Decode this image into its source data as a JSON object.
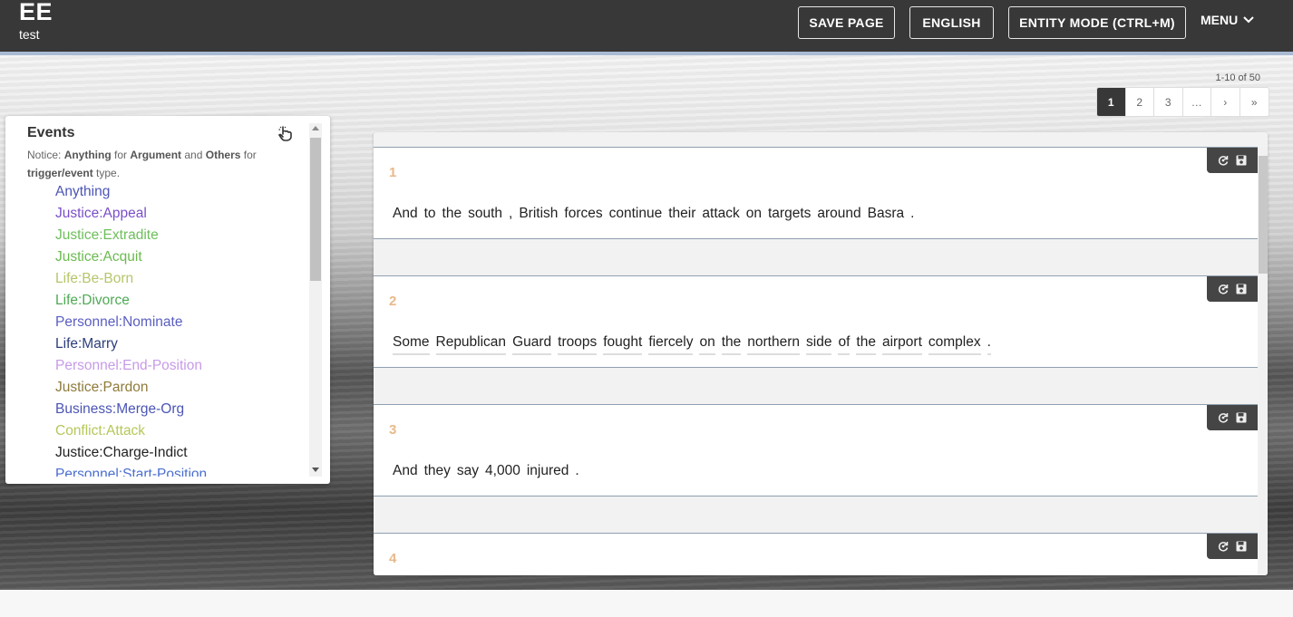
{
  "header": {
    "app_title": "EE",
    "app_subtitle": "test",
    "buttons": {
      "save_page": "SAVE PAGE",
      "language": "ENGLISH",
      "entity_mode": "ENTITY MODE (CTRL+M)",
      "menu": "MENU"
    }
  },
  "pagination": {
    "range_text": "1-10 of 50",
    "pages": [
      "1",
      "2",
      "3",
      "…",
      "›",
      "»"
    ],
    "active_page": "1"
  },
  "sidebar": {
    "title": "Events",
    "notice": {
      "prefix": "Notice: ",
      "anything": "Anything",
      "for1": " for ",
      "argument": "Argument",
      "and": " and ",
      "others": "Others",
      "for2": " for ",
      "trigger": "trigger/event",
      "suffix": " type."
    },
    "items": [
      {
        "label": "Anything",
        "color": "#4b55b5"
      },
      {
        "label": "Justice:Appeal",
        "color": "#7a4fc9"
      },
      {
        "label": "Justice:Extradite",
        "color": "#6cbf5a"
      },
      {
        "label": "Justice:Acquit",
        "color": "#6aba4f"
      },
      {
        "label": "Life:Be-Born",
        "color": "#b8c46a"
      },
      {
        "label": "Life:Divorce",
        "color": "#4faa55"
      },
      {
        "label": "Personnel:Nominate",
        "color": "#5a5ec0"
      },
      {
        "label": "Life:Marry",
        "color": "#2d3e7a"
      },
      {
        "label": "Personnel:End-Position",
        "color": "#c79be8"
      },
      {
        "label": "Justice:Pardon",
        "color": "#8f7a3a"
      },
      {
        "label": "Business:Merge-Org",
        "color": "#4b55b5"
      },
      {
        "label": "Conflict:Attack",
        "color": "#b5c75a"
      },
      {
        "label": "Justice:Charge-Indict",
        "color": "#222222"
      },
      {
        "label": "Personnel:Start-Position",
        "color": "#4b6fd0"
      }
    ]
  },
  "sentences": [
    {
      "number": "1",
      "tokens": [
        "And",
        "to",
        "the",
        "south",
        ",",
        "British",
        "forces",
        "continue",
        "their",
        "attack",
        "on",
        "targets",
        "around",
        "Basra",
        "."
      ],
      "underlined": false
    },
    {
      "number": "2",
      "tokens": [
        "Some",
        "Republican",
        "Guard",
        "troops",
        "fought",
        "fiercely",
        "on",
        "the",
        "northern",
        "side",
        "of",
        "the",
        "airport",
        "complex",
        "."
      ],
      "underlined": true
    },
    {
      "number": "3",
      "tokens": [
        "And",
        "they",
        "say",
        "4,000",
        "injured",
        "."
      ],
      "underlined": false
    },
    {
      "number": "4",
      "tokens": [],
      "underlined": false
    }
  ]
}
